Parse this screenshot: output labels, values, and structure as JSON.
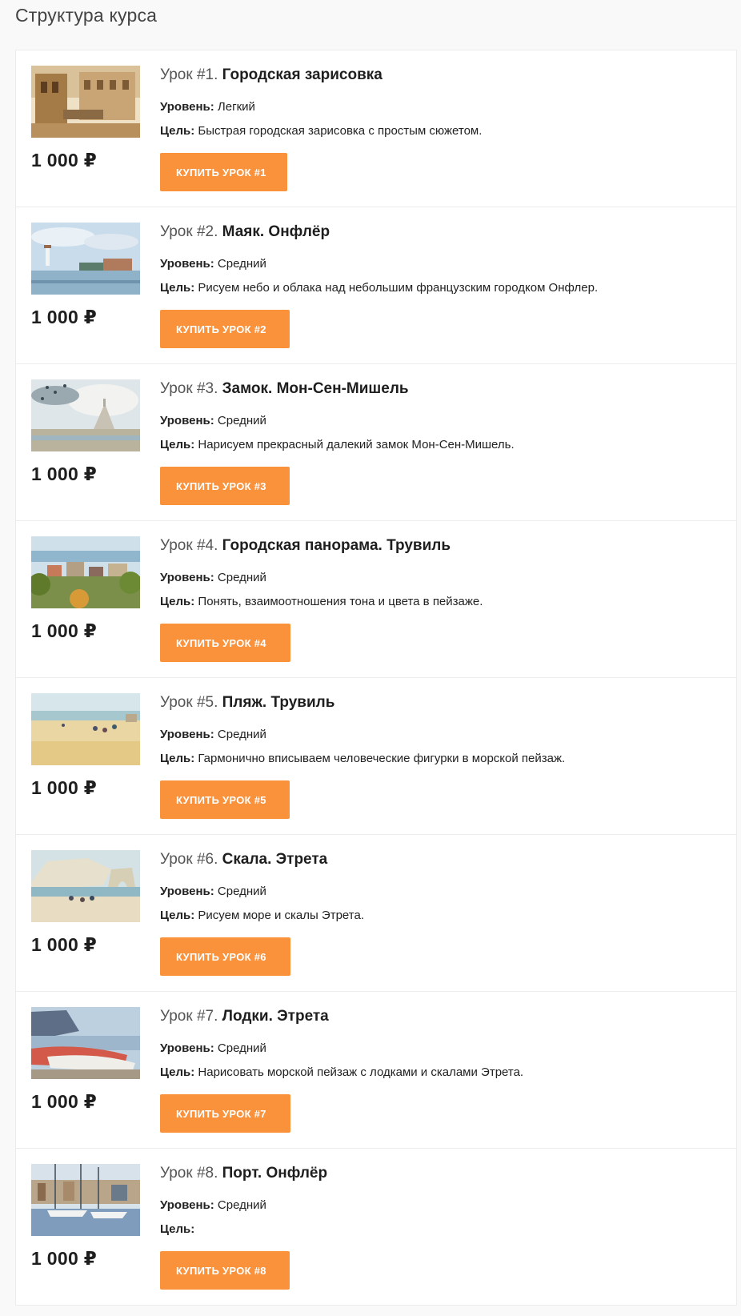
{
  "page_title": "Структура курса",
  "labels": {
    "level": "Уровень:",
    "goal": "Цель:"
  },
  "accent_color": "#fa923c",
  "lessons": [
    {
      "number": "Урок #1.",
      "name": "Городская зарисовка",
      "level": "Легкий",
      "goal": "Быстрая городская зарисовка с простым сюжетом.",
      "price": "1 000 ₽",
      "button": "КУПИТЬ УРОК #1",
      "image": "city-sketch-image"
    },
    {
      "number": "Урок #2.",
      "name": "Маяк. Онфлёр",
      "level": "Средний",
      "goal": "Рисуем небо и облака над небольшим французским городком Онфлер.",
      "price": "1 000 ₽",
      "button": "КУПИТЬ УРОК #2",
      "image": "lighthouse-honfleur-image"
    },
    {
      "number": "Урок #3.",
      "name": "Замок. Мон-Сен-Мишель",
      "level": "Средний",
      "goal": "Нарисуем прекрасный далекий замок Мон-Сен-Мишель.",
      "price": "1 000 ₽",
      "button": "КУПИТЬ УРОК #3",
      "image": "mont-saint-michel-image"
    },
    {
      "number": "Урок #4.",
      "name": "Городская панорама. Трувиль",
      "level": "Средний",
      "goal": "Понять, взаимоотношения тона и цвета в пейзаже.",
      "price": "1 000 ₽",
      "button": "КУПИТЬ УРОК #4",
      "image": "trouville-panorama-image"
    },
    {
      "number": "Урок #5.",
      "name": "Пляж. Трувиль",
      "level": "Средний",
      "goal": "Гармонично вписываем человеческие фигурки в морской пейзаж.",
      "price": "1 000 ₽",
      "button": "КУПИТЬ УРОК #5",
      "image": "trouville-beach-image"
    },
    {
      "number": "Урок #6.",
      "name": "Скала. Этрета",
      "level": "Средний",
      "goal": "Рисуем море и скалы Этрета.",
      "price": "1 000 ₽",
      "button": "КУПИТЬ УРОК #6",
      "image": "etretat-cliff-image"
    },
    {
      "number": "Урок #7.",
      "name": "Лодки. Этрета",
      "level": "Средний",
      "goal": "Нарисовать морской пейзаж с лодками и скалами Этрета.",
      "price": "1 000 ₽",
      "button": "КУПИТЬ УРОК #7",
      "image": "etretat-boats-image"
    },
    {
      "number": "Урок #8.",
      "name": "Порт. Онфлёр",
      "level": "Средний",
      "goal": "",
      "price": "1 000 ₽",
      "button": "КУПИТЬ УРОК #8",
      "image": "honfleur-port-image"
    }
  ]
}
